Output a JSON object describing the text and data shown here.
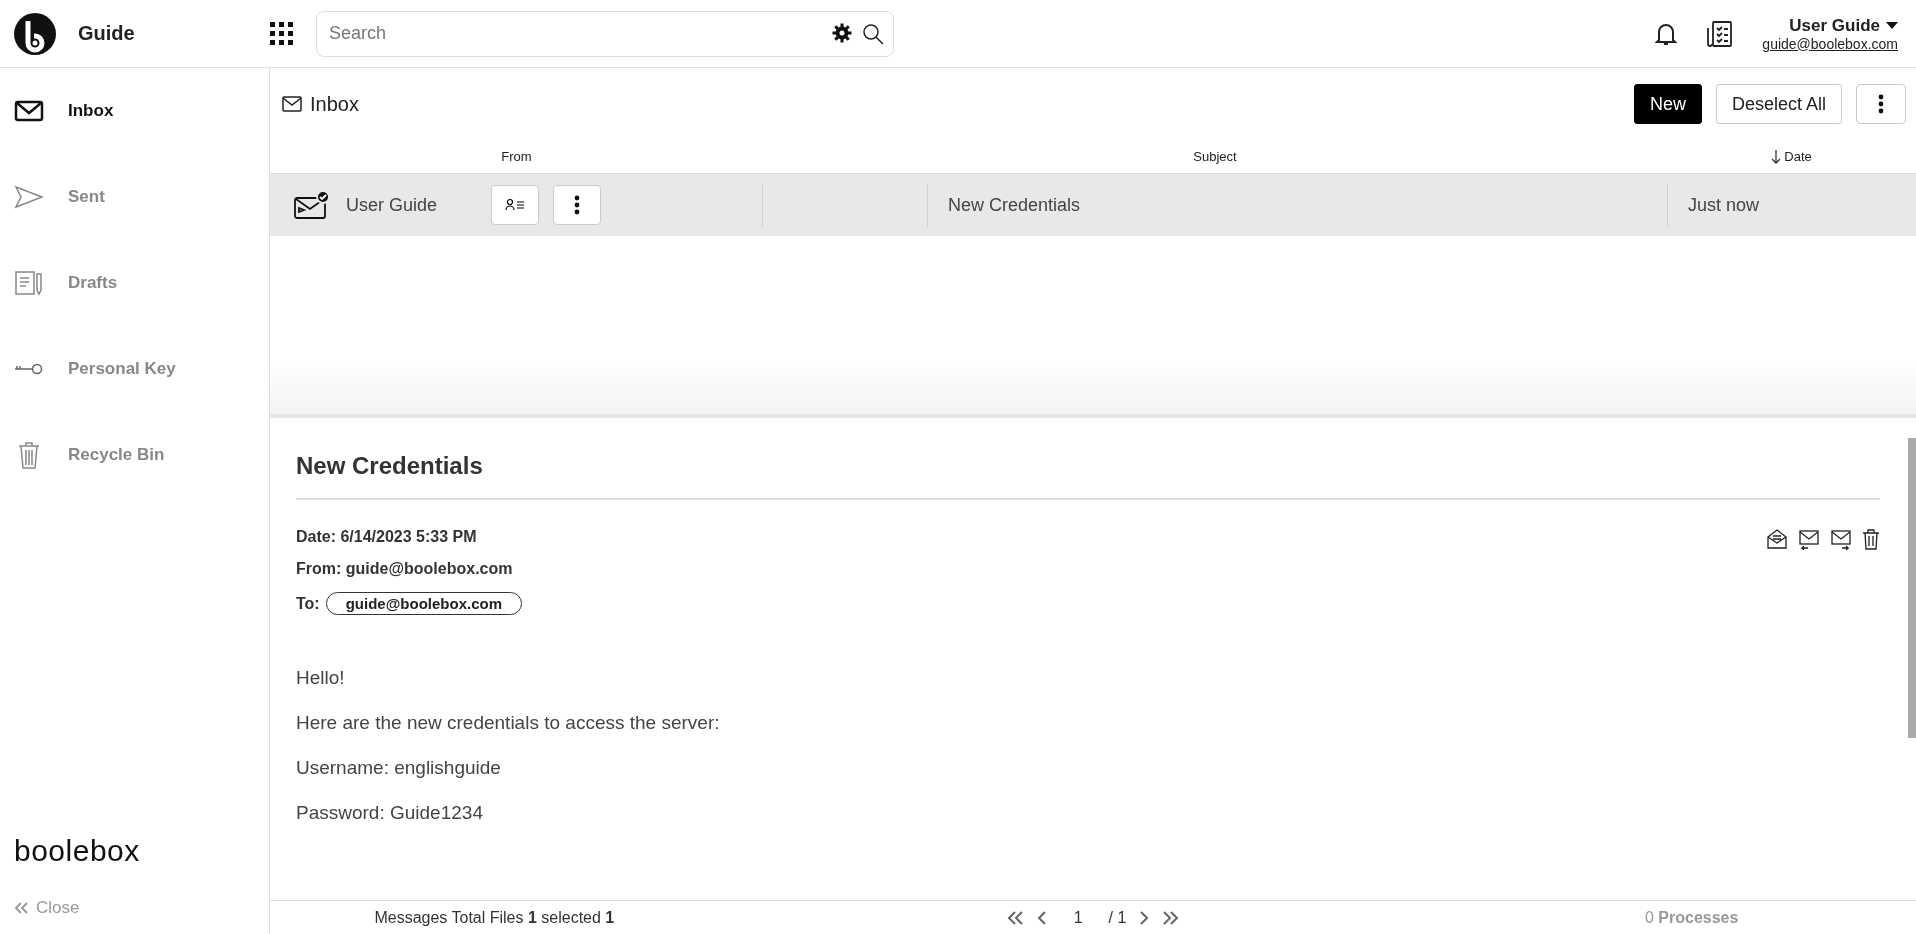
{
  "app": {
    "name": "Guide"
  },
  "search": {
    "placeholder": "Search"
  },
  "user": {
    "name": "User Guide",
    "email": "guide@boolebox.com"
  },
  "sidebar": {
    "items": [
      {
        "label": "Inbox",
        "kind": "mail",
        "selected": true
      },
      {
        "label": "Sent",
        "kind": "send",
        "selected": false
      },
      {
        "label": "Drafts",
        "kind": "drafts",
        "selected": false
      },
      {
        "label": "Personal Key",
        "kind": "key",
        "selected": false
      },
      {
        "label": "Recycle Bin",
        "kind": "trash",
        "selected": false
      }
    ],
    "brand": "boolebox",
    "close": "Close"
  },
  "mailbox": {
    "title": "Inbox",
    "buttons": [
      {
        "label": "New",
        "kind": "primary"
      },
      {
        "label": "Deselect All",
        "kind": "secondary"
      }
    ]
  },
  "table": {
    "columns": [
      {
        "label": "From",
        "sorted": false
      },
      {
        "label": "Subject",
        "sorted": false
      },
      {
        "label": "Date",
        "sorted": true
      }
    ],
    "rows": [
      {
        "from": "User Guide",
        "subject": "New Credentials",
        "date": "Just now",
        "selected": true
      }
    ]
  },
  "message": {
    "title": "New Credentials",
    "date": "Date: 6/14/2023 5:33 PM",
    "from": "From: guide@boolebox.com",
    "to_label": "To:",
    "recipients": [
      "guide@boolebox.com"
    ],
    "body": [
      "Hello!",
      "Here are the new credentials to access the server:",
      "Username: englishguide",
      "Password: Guide1234"
    ]
  },
  "status_bar": {
    "summary": "Messages Total Files **1** selected **1**",
    "page": "1",
    "pages": "/ 1",
    "processes_count": "0",
    "processes_label": "Processes"
  }
}
